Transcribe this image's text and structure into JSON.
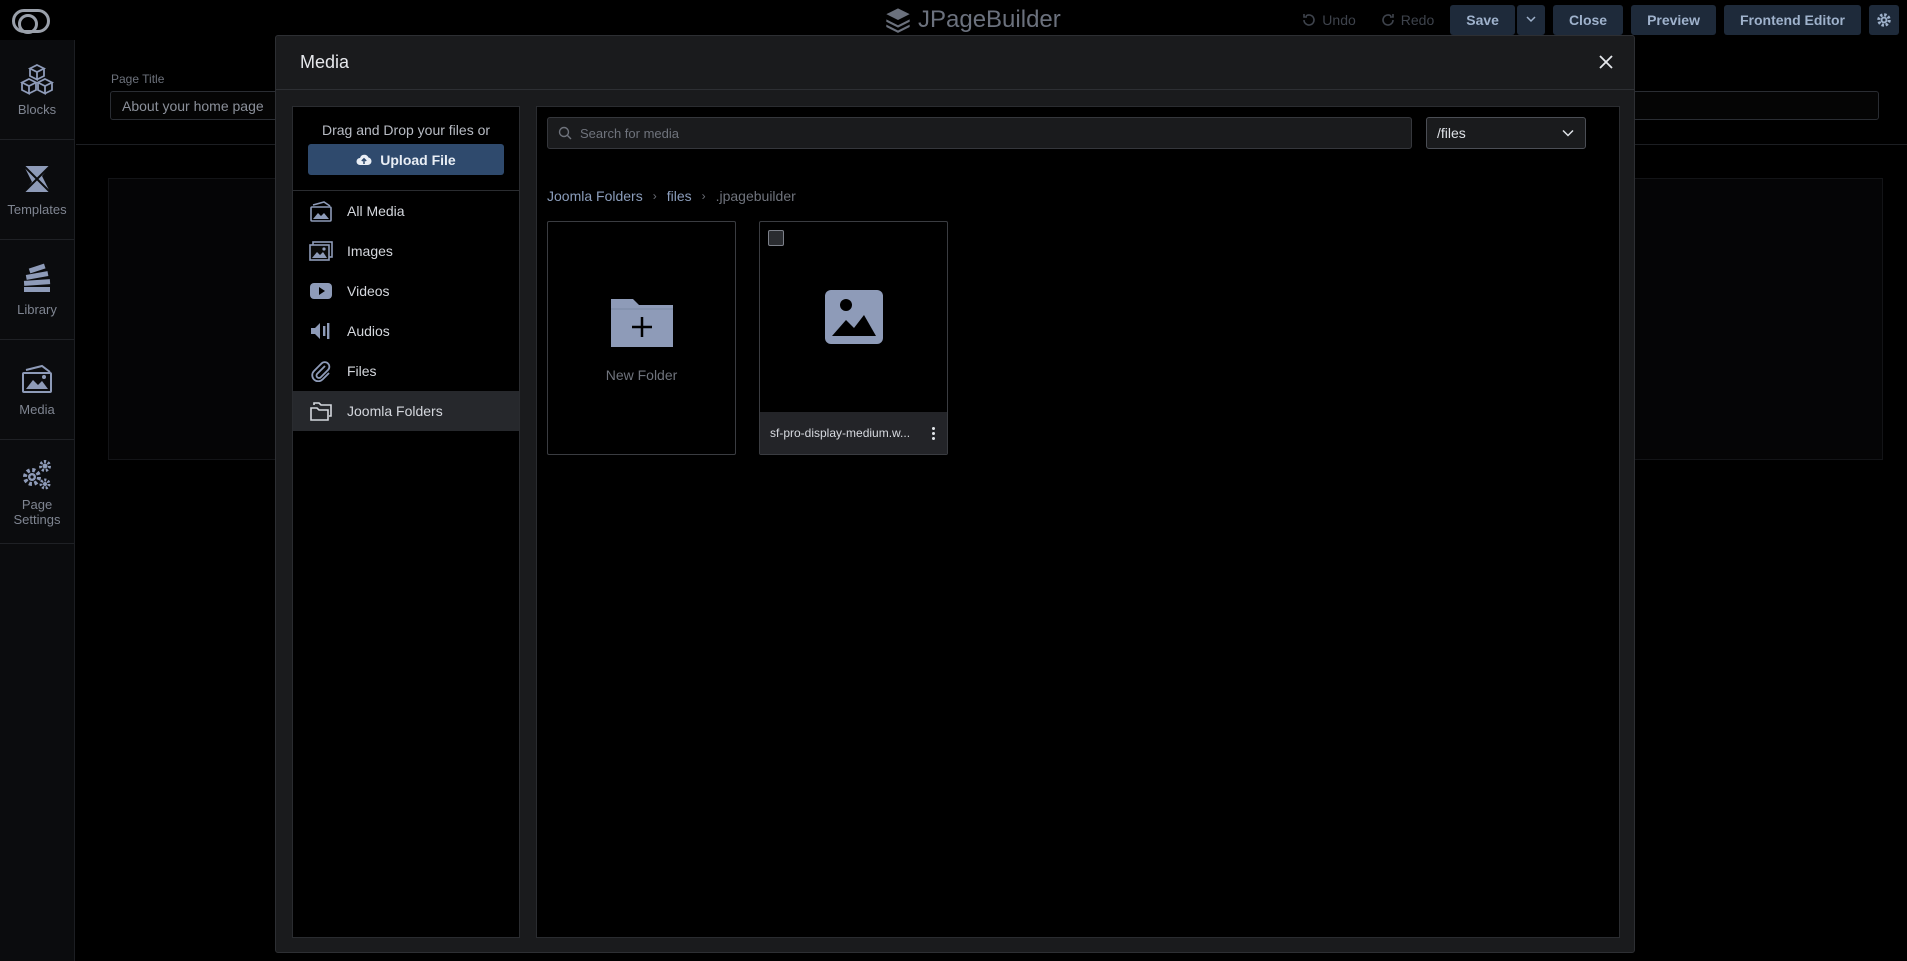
{
  "topbar": {
    "brand": "JPageBuilder",
    "undo_label": "Undo",
    "redo_label": "Redo",
    "save_label": "Save",
    "close_label": "Close",
    "preview_label": "Preview",
    "frontend_editor_label": "Frontend Editor"
  },
  "rail": {
    "items": [
      {
        "label": "Blocks"
      },
      {
        "label": "Templates"
      },
      {
        "label": "Library"
      },
      {
        "label": "Media"
      },
      {
        "label": "Page Settings"
      }
    ]
  },
  "page": {
    "title_label": "Page Title",
    "title_value": "About your home page"
  },
  "modal": {
    "title": "Media",
    "sidebar": {
      "drop_text": "Drag and Drop your files or",
      "upload_label": "Upload File",
      "items": [
        {
          "label": "All Media"
        },
        {
          "label": "Images"
        },
        {
          "label": "Videos"
        },
        {
          "label": "Audios"
        },
        {
          "label": "Files"
        },
        {
          "label": "Joomla Folders",
          "active": true
        }
      ]
    },
    "search": {
      "placeholder": "Search for media"
    },
    "folder_select": {
      "value": "/files"
    },
    "breadcrumb": [
      "Joomla Folders",
      "files",
      ".jpagebuilder"
    ],
    "tiles": {
      "new_folder_label": "New Folder",
      "file_name": "sf-pro-display-medium.w..."
    }
  },
  "colors": {
    "accent": "#2f4a6d",
    "button_dark": "#1e2a3a",
    "icon_tint": "#8e9bb8"
  }
}
